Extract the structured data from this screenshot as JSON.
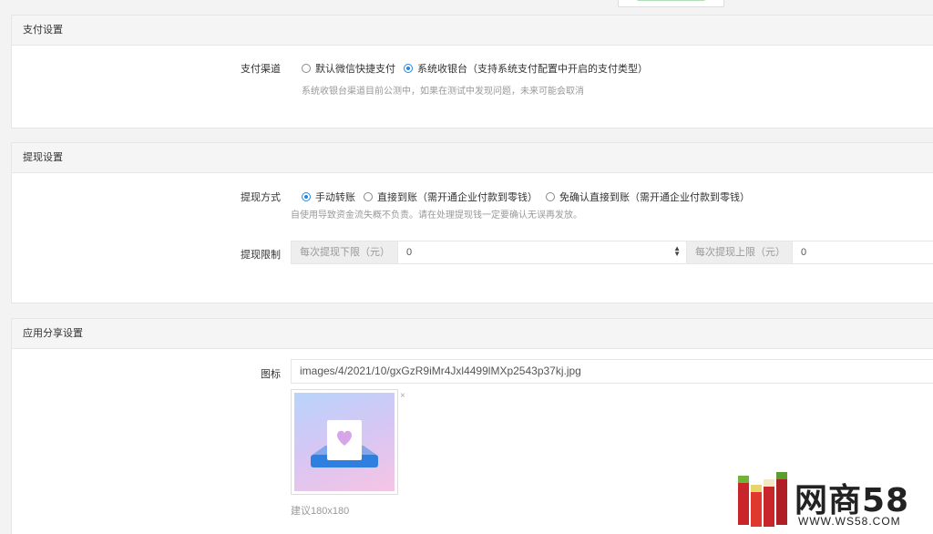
{
  "payment": {
    "title": "支付设置",
    "channel_label": "支付渠道",
    "options": [
      "默认微信快捷支付",
      "系统收银台（支持系统支付配置中开启的支付类型）"
    ],
    "selected": 1,
    "help": "系统收银台渠道目前公测中，如果在测试中发现问题，未来可能会取消"
  },
  "withdraw": {
    "title": "提现设置",
    "method_label": "提现方式",
    "options": [
      "手动转账",
      "直接到账（需开通企业付款到零钱）",
      "免确认直接到账（需开通企业付款到零钱）"
    ],
    "selected": 0,
    "help": "自使用导致资金流失概不负责。请在处理提现钱一定要确认无误再发放。",
    "limit_label": "提现限制",
    "min_addon": "每次提现下限（元）",
    "min_value": "0",
    "max_addon": "每次提现上限（元）",
    "max_value": "0"
  },
  "share": {
    "title": "应用分享设置",
    "icon_label": "图标",
    "icon_path": "images/4/2021/10/gxGzR9iMr4Jxl4499lMXp2543p37kj.jpg",
    "close_symbol": "×",
    "size_hint": "建议180x180"
  },
  "watermark": {
    "brand": "网商58",
    "url": "WWW.WS58.COM"
  },
  "colors": {
    "accent": "#1e88e5",
    "logo_red": "#c9262c",
    "logo_green": "#5a9e2f"
  }
}
